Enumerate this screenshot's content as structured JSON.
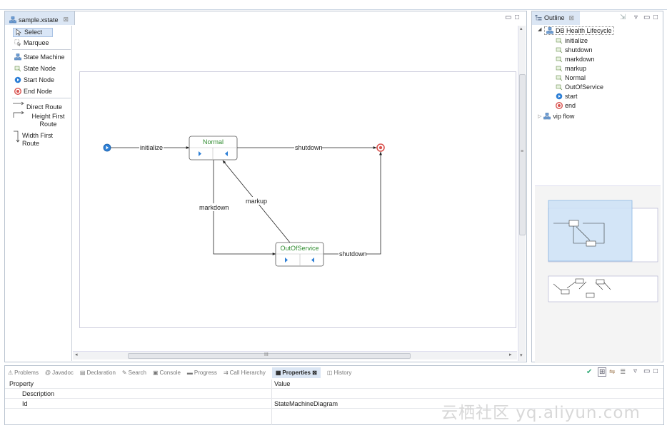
{
  "editor": {
    "tab_label": "sample.xstate",
    "tab_close": "⊠"
  },
  "palette": {
    "items": [
      {
        "label": "Select",
        "icon": "arrow-cursor-icon"
      },
      {
        "label": "Marquee",
        "icon": "marquee-icon"
      },
      {
        "label": "State Machine",
        "icon": "state-machine-icon"
      },
      {
        "label": "State Node",
        "icon": "state-node-icon"
      },
      {
        "label": "Start Node",
        "icon": "start-node-icon"
      },
      {
        "label": "End Node",
        "icon": "end-node-icon"
      },
      {
        "label": "Direct Route",
        "icon": "direct-route-icon"
      },
      {
        "label": "Height First Route",
        "icon": "height-first-route-icon"
      },
      {
        "label": "Width First Route",
        "icon": "width-first-route-icon"
      }
    ]
  },
  "diagram": {
    "nodes": {
      "normal": "Normal",
      "out_of_service": "OutOfService"
    },
    "edges": {
      "initialize": "initialize",
      "shutdown_top": "shutdown",
      "shutdown_bottom": "shutdown",
      "markdown": "markdown",
      "markup": "markup"
    },
    "colors": {
      "node_title": "#2e8b2e",
      "start": "#2d7fd6",
      "end": "#d9534f"
    }
  },
  "hscroll_label": "III",
  "vscroll_label": "≡",
  "outline": {
    "tab_label": "Outline",
    "tab_close": "⊠",
    "root": "DB Health Lifecycle",
    "children": [
      "initialize",
      "shutdown",
      "markdown",
      "markup",
      "Normal",
      "OutOfService",
      "start",
      "end"
    ],
    "sibling": "vip flow"
  },
  "bottom": {
    "tabs": [
      {
        "label": "Problems",
        "icon": "problems-icon"
      },
      {
        "label": "Javadoc",
        "icon": "javadoc-icon"
      },
      {
        "label": "Declaration",
        "icon": "declaration-icon"
      },
      {
        "label": "Search",
        "icon": "search-icon"
      },
      {
        "label": "Console",
        "icon": "console-icon"
      },
      {
        "label": "Progress",
        "icon": "progress-icon"
      },
      {
        "label": "Call Hierarchy",
        "icon": "call-hierarchy-icon"
      },
      {
        "label": "Properties ⊠",
        "icon": "properties-icon",
        "active": true
      },
      {
        "label": "History",
        "icon": "history-icon"
      }
    ],
    "header_property": "Property",
    "header_value": "Value",
    "rows": [
      {
        "property": "Description",
        "value": ""
      },
      {
        "property": "Id",
        "value": "StateMachineDiagram"
      }
    ]
  },
  "watermark": "云栖社区 yq.aliyun.com"
}
